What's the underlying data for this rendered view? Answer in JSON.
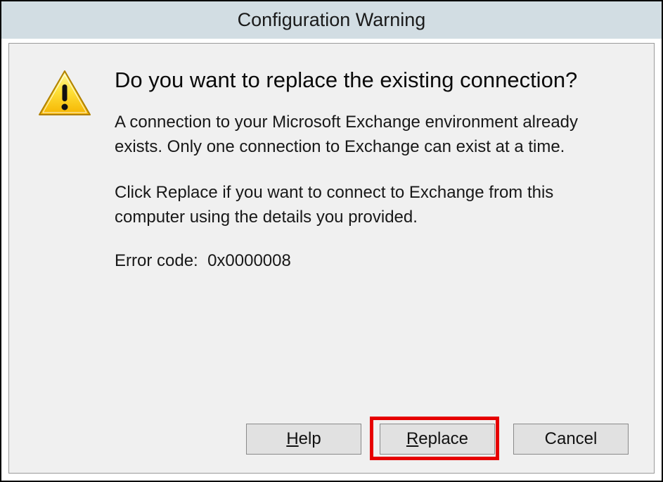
{
  "titlebar": {
    "title": "Configuration Warning"
  },
  "dialog": {
    "heading": "Do you want to replace the existing connection?",
    "paragraph1": "A connection to your Microsoft Exchange environment already exists. Only one connection to Exchange can exist at a time.",
    "paragraph2": "Click Replace if you want to connect to Exchange from this computer using the details you provided.",
    "error_label": "Error code:",
    "error_code": "0x0000008"
  },
  "buttons": {
    "help_prefix": "H",
    "help_rest": "elp",
    "replace_prefix": "R",
    "replace_rest": "eplace",
    "cancel": "Cancel"
  },
  "icon": {
    "name": "warning-icon"
  }
}
